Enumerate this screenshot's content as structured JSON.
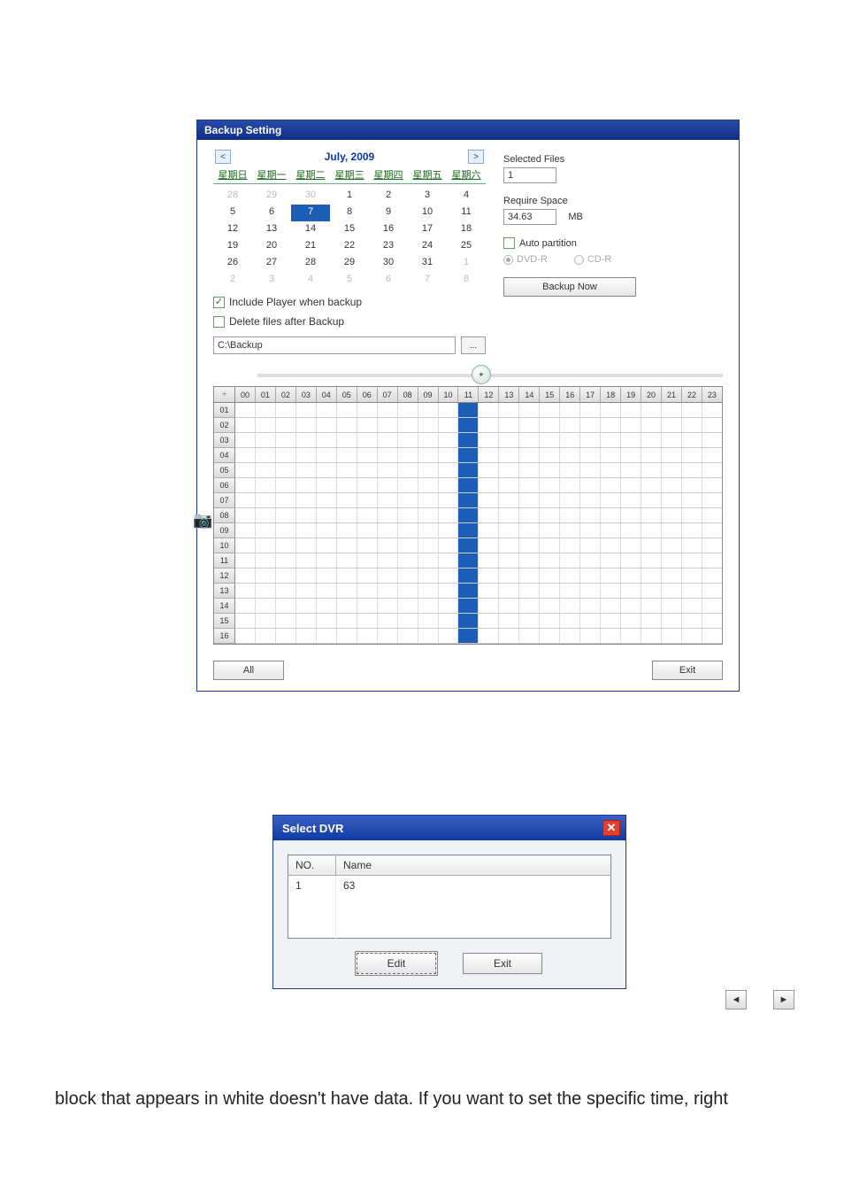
{
  "backup_window": {
    "title": "Backup Setting",
    "calendar": {
      "month_label": "July, 2009",
      "dow": [
        "星期日",
        "星期一",
        "星期二",
        "星期三",
        "星期四",
        "星期五",
        "星期六"
      ],
      "rows": [
        [
          {
            "d": "28",
            "out": true
          },
          {
            "d": "29",
            "out": true
          },
          {
            "d": "30",
            "out": true
          },
          {
            "d": "1"
          },
          {
            "d": "2"
          },
          {
            "d": "3"
          },
          {
            "d": "4"
          }
        ],
        [
          {
            "d": "5"
          },
          {
            "d": "6"
          },
          {
            "d": "7",
            "sel": true
          },
          {
            "d": "8"
          },
          {
            "d": "9"
          },
          {
            "d": "10"
          },
          {
            "d": "11"
          }
        ],
        [
          {
            "d": "12"
          },
          {
            "d": "13"
          },
          {
            "d": "14"
          },
          {
            "d": "15"
          },
          {
            "d": "16"
          },
          {
            "d": "17"
          },
          {
            "d": "18"
          }
        ],
        [
          {
            "d": "19"
          },
          {
            "d": "20"
          },
          {
            "d": "21"
          },
          {
            "d": "22"
          },
          {
            "d": "23"
          },
          {
            "d": "24"
          },
          {
            "d": "25"
          }
        ],
        [
          {
            "d": "26"
          },
          {
            "d": "27"
          },
          {
            "d": "28"
          },
          {
            "d": "29"
          },
          {
            "d": "30"
          },
          {
            "d": "31"
          },
          {
            "d": "1",
            "out": true
          }
        ],
        [
          {
            "d": "2",
            "out": true
          },
          {
            "d": "3",
            "out": true
          },
          {
            "d": "4",
            "out": true
          },
          {
            "d": "5",
            "out": true
          },
          {
            "d": "6",
            "out": true
          },
          {
            "d": "7",
            "out": true
          },
          {
            "d": "8",
            "out": true
          }
        ]
      ]
    },
    "include_player": {
      "label": "Include Player when backup",
      "checked": true
    },
    "delete_after": {
      "label": "Delete files after Backup",
      "checked": false
    },
    "path": "C:\\Backup",
    "browse_label": "...",
    "selected_files": {
      "label": "Selected Files",
      "value": "1"
    },
    "require_space": {
      "label": "Require Space",
      "value": "34.63",
      "unit": "MB"
    },
    "auto_partition": {
      "label": "Auto partition",
      "checked": false
    },
    "disc": {
      "dvd_label": "DVD-R",
      "cd_label": "CD-R",
      "selected": "dvd"
    },
    "backup_now_label": "Backup Now",
    "timeline": {
      "corner": "÷",
      "hours": [
        "00",
        "01",
        "02",
        "03",
        "04",
        "05",
        "06",
        "07",
        "08",
        "09",
        "10",
        "11",
        "12",
        "13",
        "14",
        "15",
        "16",
        "17",
        "18",
        "19",
        "20",
        "21",
        "22",
        "23"
      ],
      "cameras": [
        "01",
        "02",
        "03",
        "04",
        "05",
        "06",
        "07",
        "08",
        "09",
        "10",
        "11",
        "12",
        "13",
        "14",
        "15",
        "16"
      ],
      "mark_hour": 11
    },
    "all_label": "All",
    "exit_label": "Exit"
  },
  "select_dvr": {
    "title": "Select DVR",
    "columns": [
      "NO.",
      "Name"
    ],
    "rows": [
      {
        "no": "1",
        "name": "63"
      }
    ],
    "edit_label": "Edit",
    "exit_label": "Exit"
  },
  "caption": "block that appears in white doesn't have data. If you want to set the specific time, right"
}
